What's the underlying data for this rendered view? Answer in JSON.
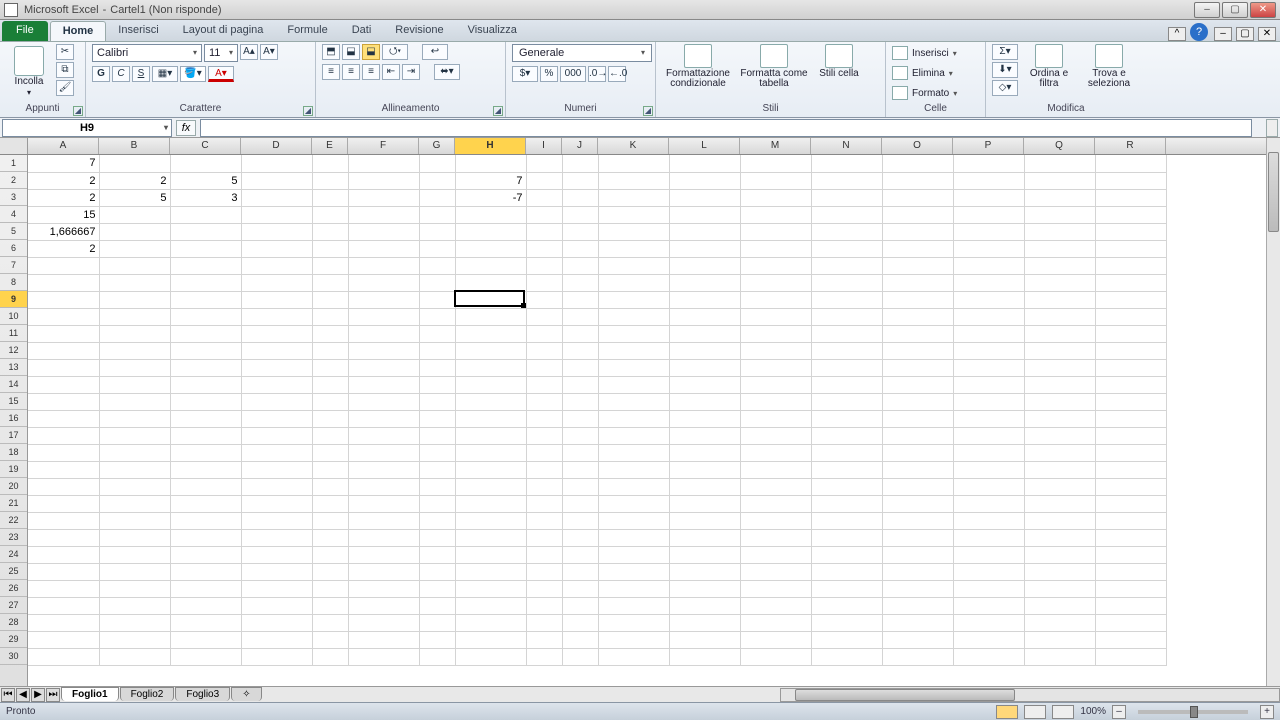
{
  "window": {
    "app": "Microsoft Excel",
    "doc": "Cartel1 (Non risponde)"
  },
  "tabs": {
    "file": "File",
    "items": [
      "Home",
      "Inserisci",
      "Layout di pagina",
      "Formule",
      "Dati",
      "Revisione",
      "Visualizza"
    ],
    "active": 0
  },
  "ribbon": {
    "clipboard": {
      "paste": "Incolla",
      "label": "Appunti"
    },
    "font": {
      "name": "Calibri",
      "size": "11",
      "bold": "G",
      "italic": "C",
      "underline": "S",
      "label": "Carattere"
    },
    "align": {
      "label": "Allineamento"
    },
    "number": {
      "format": "Generale",
      "label": "Numeri",
      "pct": "%",
      "thou": "000"
    },
    "styles": {
      "cond": "Formattazione condizionale",
      "table": "Formatta come tabella",
      "cell": "Stili cella",
      "label": "Stili"
    },
    "cells": {
      "insert": "Inserisci",
      "delete": "Elimina",
      "format": "Formato",
      "label": "Celle"
    },
    "editing": {
      "sort": "Ordina e filtra",
      "find": "Trova e seleziona",
      "label": "Modifica"
    }
  },
  "formula_bar": {
    "name": "H9",
    "formula": ""
  },
  "columns": {
    "letters": [
      "A",
      "B",
      "C",
      "D",
      "E",
      "F",
      "G",
      "H",
      "I",
      "J",
      "K",
      "L",
      "M",
      "N",
      "O",
      "P",
      "Q",
      "R"
    ],
    "widths": [
      71,
      71,
      71,
      71,
      36,
      71,
      36,
      71,
      36,
      36,
      71,
      71,
      71,
      71,
      71,
      71,
      71,
      71
    ],
    "selected_index": 7
  },
  "rows": {
    "count": 30,
    "selected_index": 8
  },
  "cells": {
    "A1": "7",
    "A2": "2",
    "B2": "2",
    "C2": "5",
    "H2": "7",
    "A3": "2",
    "B3": "5",
    "C3": "3",
    "H3": "-7",
    "A4": "15",
    "A5": "1,666667",
    "A6": "2"
  },
  "active_cell": {
    "col": 7,
    "row": 8
  },
  "sheets": {
    "tabs": [
      "Foglio1",
      "Foglio2",
      "Foglio3"
    ],
    "active": 0
  },
  "status": {
    "ready": "Pronto",
    "zoom": "100%"
  }
}
